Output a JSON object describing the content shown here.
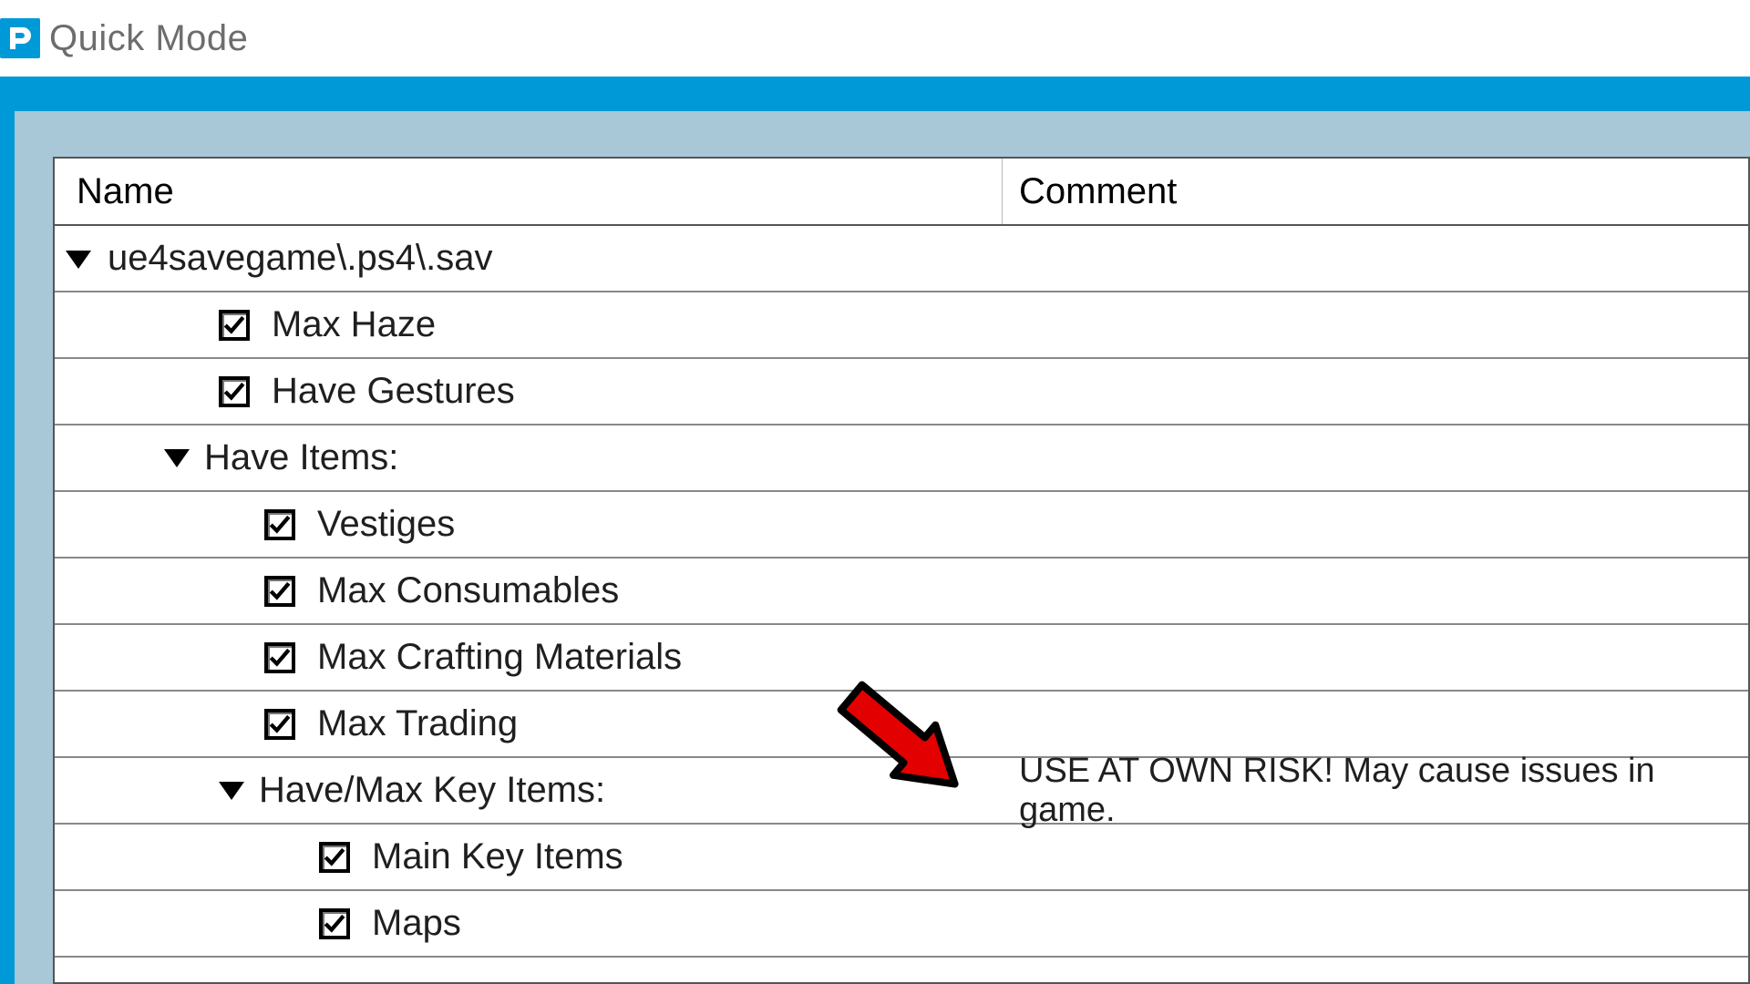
{
  "window": {
    "title": "Quick Mode"
  },
  "columns": {
    "name": "Name",
    "comment": "Comment"
  },
  "tree": {
    "root": {
      "label": "ue4savegame\\.ps4\\.sav"
    },
    "items": [
      {
        "label": "Max Haze"
      },
      {
        "label": "Have Gestures"
      }
    ],
    "have_items": {
      "label": "Have Items:",
      "children": [
        {
          "label": "Vestiges"
        },
        {
          "label": "Max Consumables"
        },
        {
          "label": "Max Crafting Materials"
        },
        {
          "label": "Max Trading"
        }
      ]
    },
    "key_items": {
      "label": "Have/Max Key Items:",
      "comment": "USE AT OWN RISK! May cause issues in game.",
      "children": [
        {
          "label": "Main Key Items"
        },
        {
          "label": "Maps"
        }
      ]
    }
  }
}
